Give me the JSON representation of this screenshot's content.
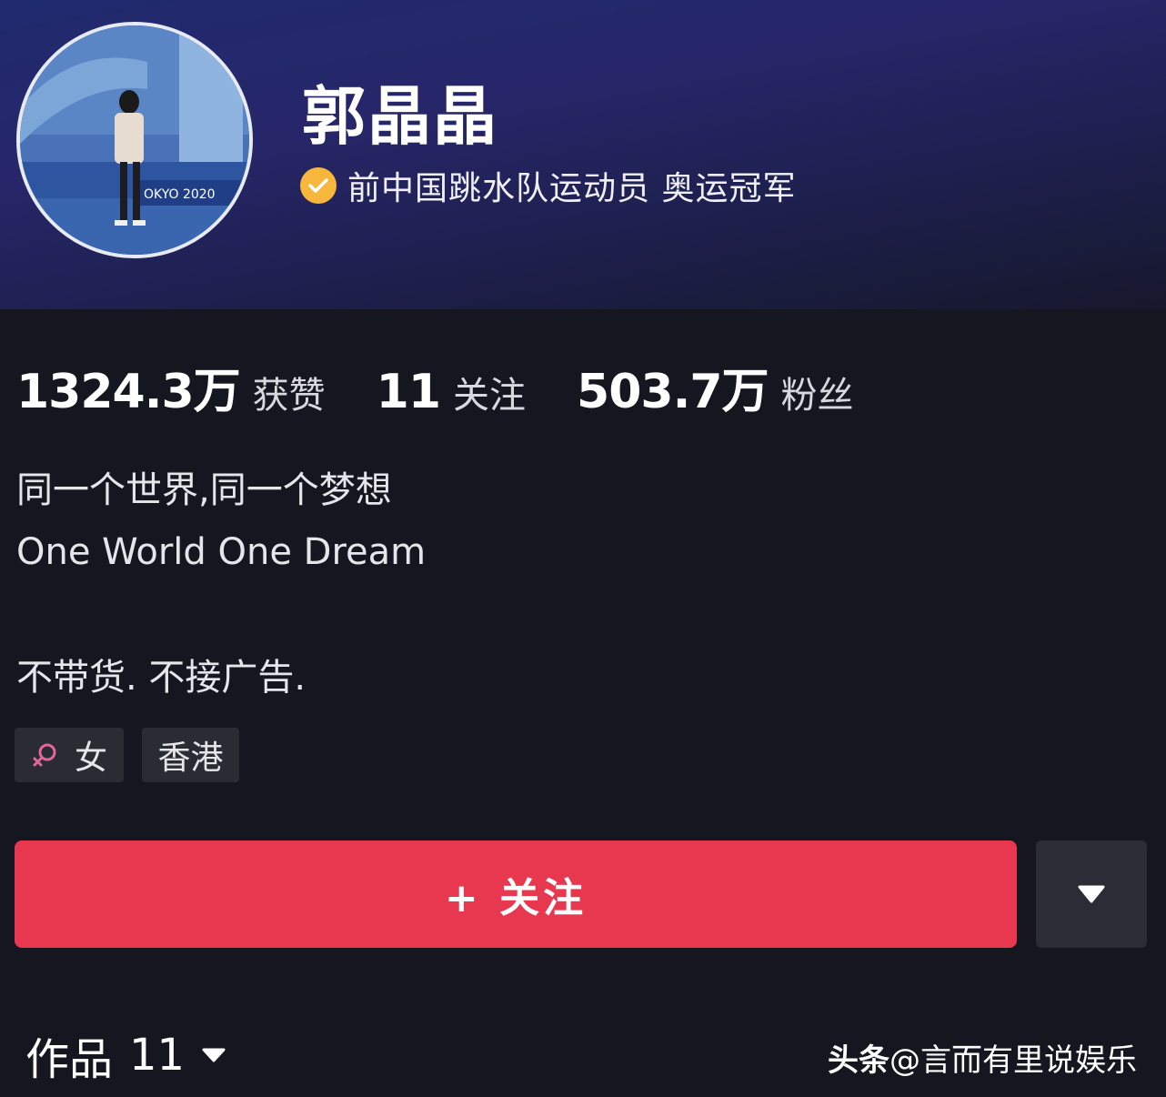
{
  "profile": {
    "name": "郭晶晶",
    "verified_text": "前中国跳水队运动员 奥运冠军",
    "avatar_caption": "OKYO 2020"
  },
  "stats": [
    {
      "value": "1324.3万",
      "label": "获赞"
    },
    {
      "value": "11",
      "label": "关注"
    },
    {
      "value": "503.7万",
      "label": "粉丝"
    }
  ],
  "bio": {
    "line1": "同一个世界,同一个梦想",
    "line2": "One World One Dream",
    "line3": "不带货. 不接广告."
  },
  "tags": {
    "gender": "女",
    "location": "香港"
  },
  "actions": {
    "follow_label": "+ 关注"
  },
  "works": {
    "label": "作品",
    "count": "11"
  },
  "watermark": {
    "brand": "头条",
    "handle": "@言而有里说娱乐"
  },
  "colors": {
    "follow_button": "#e8384f",
    "verified_badge": "#f6b73c",
    "gender_icon": "#e0679a"
  },
  "icons": {
    "verified": "verified-check-icon",
    "gender": "female-icon",
    "dropdown": "triangle-down-icon"
  }
}
